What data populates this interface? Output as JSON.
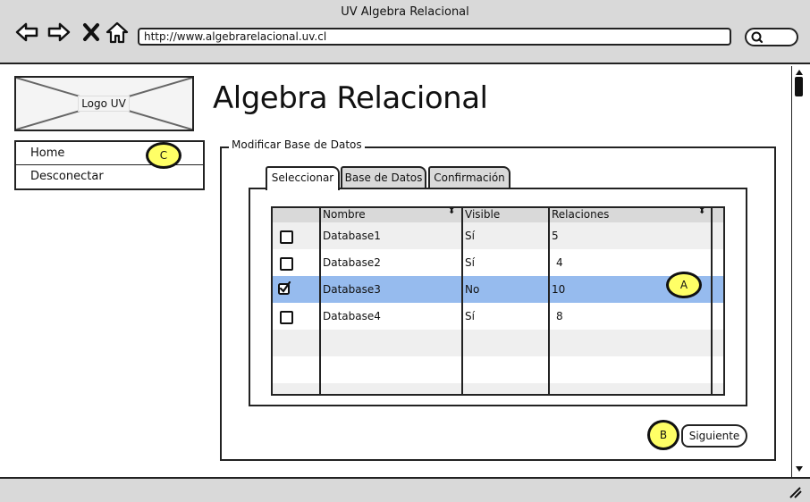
{
  "window": {
    "title": "UV Algebra Relacional",
    "url": "http://www.algebrarelacional.uv.cl"
  },
  "browser_icons": [
    "back-arrow-icon",
    "forward-arrow-icon",
    "close-x-icon",
    "home-icon",
    "search-icon"
  ],
  "logo": {
    "label": "Logo UV"
  },
  "page_title": "Algebra Relacional",
  "menu": {
    "items": [
      "Home",
      "Desconectar"
    ]
  },
  "markers": {
    "a": "A",
    "b": "B",
    "c": "C"
  },
  "panel": {
    "legend": "Modificar Base de Datos",
    "tabs": [
      "Seleccionar",
      "Base de Datos",
      "Confirmación"
    ],
    "selected_tab": "Seleccionar"
  },
  "table": {
    "columns": [
      "Nombre",
      "Visible",
      "Relaciones"
    ],
    "rows": [
      {
        "checked": false,
        "name": "Database1",
        "visible": "Sí",
        "relations": "5"
      },
      {
        "checked": false,
        "name": "Database2",
        "visible": "Sí",
        "relations": "4"
      },
      {
        "checked": true,
        "name": "Database3",
        "visible": "No",
        "relations": "10"
      },
      {
        "checked": false,
        "name": "Database4",
        "visible": "Sí",
        "relations": "8"
      }
    ]
  },
  "next_button": "Siguiente",
  "colors": {
    "chrome": "#d9d9d9",
    "selected_row": "#96bbee",
    "marker": "#ffff66",
    "alt_row": "#efefef"
  }
}
